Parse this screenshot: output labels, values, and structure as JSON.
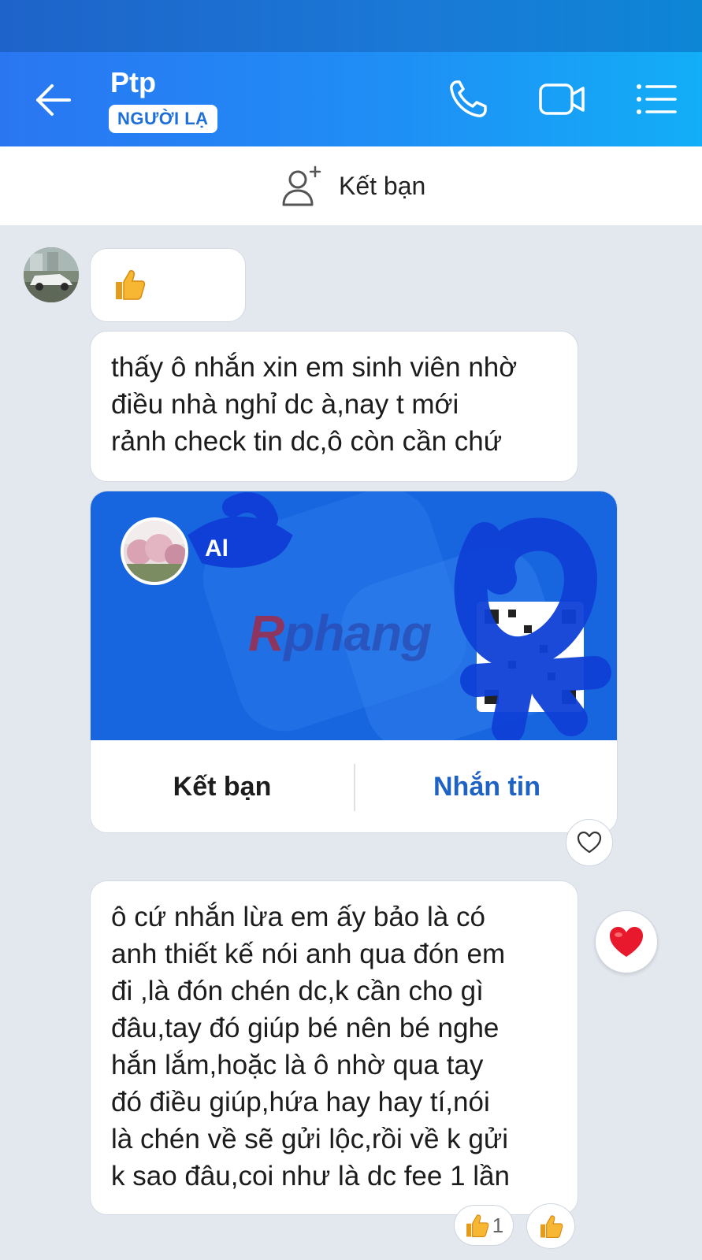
{
  "header": {
    "contact_name": "Ptp",
    "badge": "NGƯỜI LẠ"
  },
  "add_friend_bar": {
    "label": "Kết bạn"
  },
  "messages": [
    {
      "type": "sticker",
      "content": "thumbs-up"
    },
    {
      "type": "text",
      "text": "thấy ô nhắn xin em sinh viên nhờ\nđiều nhà nghỉ dc à,nay t mới\nrảnh check tin dc,ô còn cần chứ"
    },
    {
      "type": "contact_card",
      "name": "Al",
      "watermark": "Rphang",
      "add_button": "Kết bạn",
      "message_button": "Nhắn tin"
    },
    {
      "type": "text",
      "text": "ô cứ nhắn lừa em ấy bảo là có\nanh thiết kế nói anh qua đón em\nđi ,là đón chén dc,k cần cho gì\nđâu,tay đó giúp bé nên bé nghe\nhắn lắm,hoặc là ô nhờ qua tay\nđó điều giúp,hứa hay hay tí,nói\nlà chén về sẽ gửi lộc,rồi về k gửi\nk sao đâu,coi như là dc fee 1 lần"
    }
  ],
  "reactions": {
    "like_count": "1"
  },
  "colors": {
    "header_start": "#2a76f2",
    "header_end": "#12aef7",
    "card_blue": "#1766e0",
    "message_link": "#1e62c5",
    "background": "#e3e8ef"
  }
}
